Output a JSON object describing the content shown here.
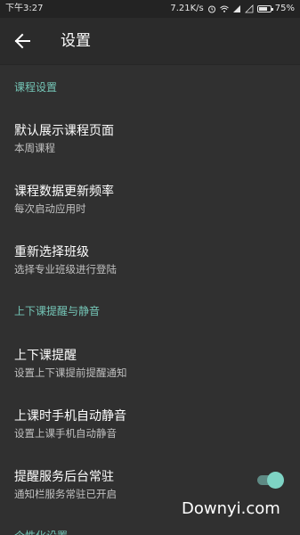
{
  "status_bar": {
    "time": "下午3:27",
    "net_speed": "7.21K/s",
    "battery": "75%",
    "battery_level": 0.75
  },
  "app_bar": {
    "title": "设置",
    "back_icon": "arrow-back-icon"
  },
  "sections": [
    {
      "header": "课程设置",
      "items": [
        {
          "title": "默认展示课程页面",
          "summary": "本周课程"
        },
        {
          "title": "课程数据更新频率",
          "summary": "每次启动应用时"
        },
        {
          "title": "重新选择班级",
          "summary": "选择专业班级进行登陆"
        }
      ]
    },
    {
      "header": "上下课提醒与静音",
      "items": [
        {
          "title": "上下课提醒",
          "summary": "设置上下课提前提醒通知"
        },
        {
          "title": "上课时手机自动静音",
          "summary": "设置上课手机自动静音"
        },
        {
          "title": "提醒服务后台常驻",
          "summary": "通知栏服务常驻已开启",
          "toggle_on": true
        }
      ]
    },
    {
      "header": "个性化设置",
      "items": []
    }
  ],
  "watermark": "Downyi.com",
  "colors": {
    "accent": "#74c5b6",
    "background": "#303030",
    "app_bar": "#2b2b2b",
    "status_bar": "#232323"
  }
}
